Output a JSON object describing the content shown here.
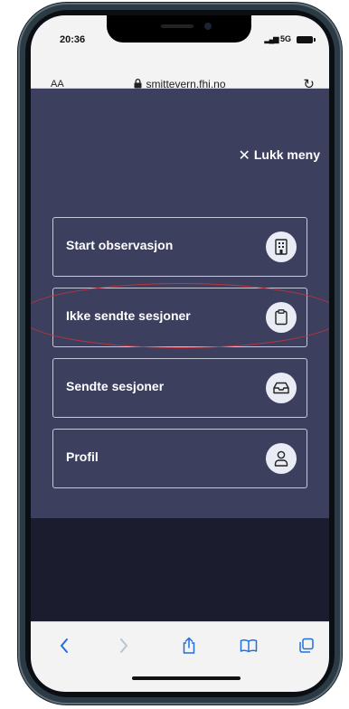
{
  "status_bar": {
    "time": "20:36",
    "network": "5G"
  },
  "browser": {
    "aa_label": "AA",
    "url": "smittevern.fhi.no"
  },
  "menu": {
    "close_label": "Lukk meny",
    "items": [
      {
        "label": "Start observasjon",
        "icon": "building-icon"
      },
      {
        "label": "Ikke sendte sesjoner",
        "icon": "clipboard-icon"
      },
      {
        "label": "Sendte sesjoner",
        "icon": "inbox-icon"
      },
      {
        "label": "Profil",
        "icon": "user-icon"
      }
    ]
  },
  "colors": {
    "menu_background": "#3d3f5f",
    "page_background": "#1b1d2e",
    "icon_circle": "#e9ecf4",
    "highlight": "#c2353b",
    "safari_accent": "#1f6fe0"
  }
}
